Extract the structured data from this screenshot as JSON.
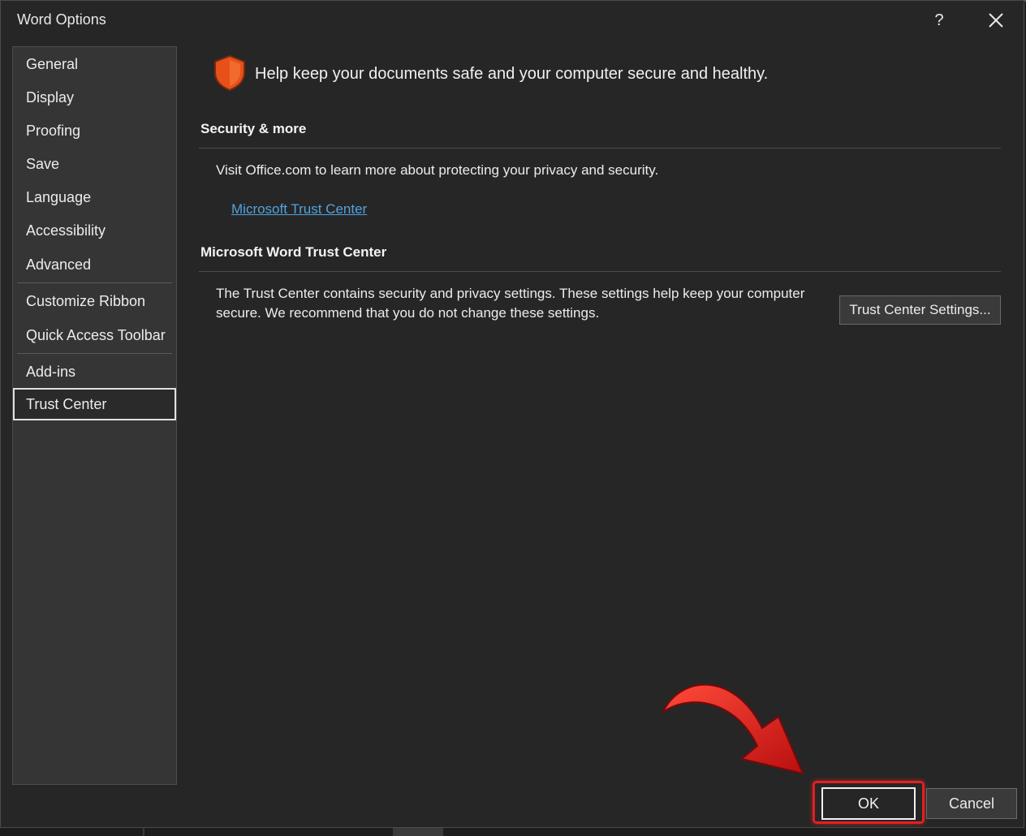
{
  "window": {
    "title": "Word Options",
    "help_label": "?"
  },
  "sidebar": {
    "items": [
      {
        "label": "General"
      },
      {
        "label": "Display"
      },
      {
        "label": "Proofing"
      },
      {
        "label": "Save"
      },
      {
        "label": "Language"
      },
      {
        "label": "Accessibility"
      },
      {
        "label": "Advanced"
      },
      {
        "label": "Customize Ribbon"
      },
      {
        "label": "Quick Access Toolbar"
      },
      {
        "label": "Add-ins"
      },
      {
        "label": "Trust Center"
      }
    ],
    "selected": "Trust Center"
  },
  "main": {
    "headline": "Help keep your documents safe and your computer secure and healthy.",
    "security_section": {
      "title": "Security & more",
      "text": "Visit Office.com to learn more about protecting your privacy and security.",
      "link": "Microsoft Trust Center"
    },
    "trust_center_section": {
      "title": "Microsoft Word Trust Center",
      "text_line1": "The Trust Center contains security and privacy settings. These settings help keep your computer",
      "text_line2": "secure. We recommend that you do not change these settings.",
      "button_label": "Trust Center Settings..."
    }
  },
  "footer": {
    "ok_label": "OK",
    "cancel_label": "Cancel"
  },
  "colors": {
    "accent_link": "#4fa3e0",
    "shield": "#e8501a",
    "annotation": "#e02020"
  }
}
